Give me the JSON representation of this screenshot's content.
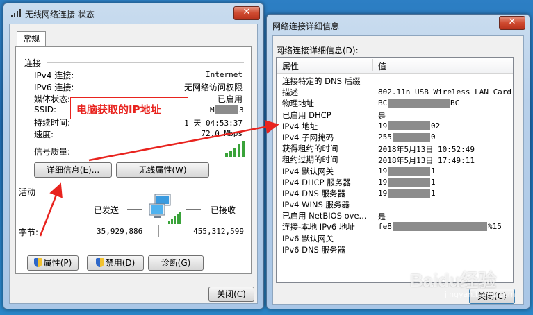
{
  "status_window": {
    "title": "无线网络连接 状态",
    "tab": "常规",
    "connection": {
      "section_label": "连接",
      "rows": [
        {
          "label": "IPv4 连接:",
          "value": "Internet"
        },
        {
          "label": "IPv6 连接:",
          "value": "无网络访问权限"
        },
        {
          "label": "媒体状态:",
          "value": "已启用"
        },
        {
          "label": "SSID:",
          "value_left": "M",
          "value_right": "3"
        },
        {
          "label": "持续时间:",
          "value": "1 天 04:53:37"
        },
        {
          "label": "速度:",
          "value": "72.0 Mbps"
        }
      ],
      "signal_label": "信号质量:"
    },
    "buttons": {
      "details": "详细信息(E)...",
      "wireless_props": "无线属性(W)"
    },
    "activity": {
      "section_label": "活动",
      "sent_label": "已发送",
      "received_label": "已接收",
      "bytes_label": "字节:",
      "sent_bytes": "35,929,886",
      "received_bytes": "455,312,599"
    },
    "bottom_buttons": {
      "properties": "属性(P)",
      "disable": "禁用(D)",
      "diagnose": "诊断(G)"
    },
    "close": "关闭(C)"
  },
  "annotation": {
    "text": "电脑获取的IP地址",
    "color": "#e8231e"
  },
  "details_window": {
    "title": "网络连接详细信息",
    "list_caption": "网络连接详细信息(D):",
    "columns": [
      "属性",
      "值"
    ],
    "rows": [
      {
        "prop": "连接特定的 DNS 后缀",
        "val": ""
      },
      {
        "prop": "描述",
        "val": "802.11n USB Wireless LAN Card"
      },
      {
        "prop": "物理地址",
        "val": "BC",
        "tail": "BC"
      },
      {
        "prop": "已启用 DHCP",
        "val": "是"
      },
      {
        "prop": "IPv4 地址",
        "val": "19",
        "tail": "02"
      },
      {
        "prop": "IPv4 子网掩码",
        "val": "255",
        "tail": "0"
      },
      {
        "prop": "获得租约的时间",
        "val": "2018年5月13日 10:52:49"
      },
      {
        "prop": "租约过期的时间",
        "val": "2018年5月13日 17:49:11"
      },
      {
        "prop": "IPv4 默认网关",
        "val": "19",
        "tail": "1"
      },
      {
        "prop": "IPv4 DHCP 服务器",
        "val": "19",
        "tail": "1"
      },
      {
        "prop": "IPv4 DNS 服务器",
        "val": "19",
        "tail": "1"
      },
      {
        "prop": "IPv4 WINS 服务器",
        "val": ""
      },
      {
        "prop": "已启用 NetBIOS ove...",
        "val": "是"
      },
      {
        "prop": "连接-本地 IPv6 地址",
        "val": "fe8",
        "tail": "%15"
      },
      {
        "prop": "IPv6 默认网关",
        "val": ""
      },
      {
        "prop": "IPv6 DNS 服务器",
        "val": ""
      }
    ],
    "close": "关闭(C)"
  },
  "watermark": {
    "brand": "Baidu经验",
    "url": "jingyan.baidu.com"
  }
}
